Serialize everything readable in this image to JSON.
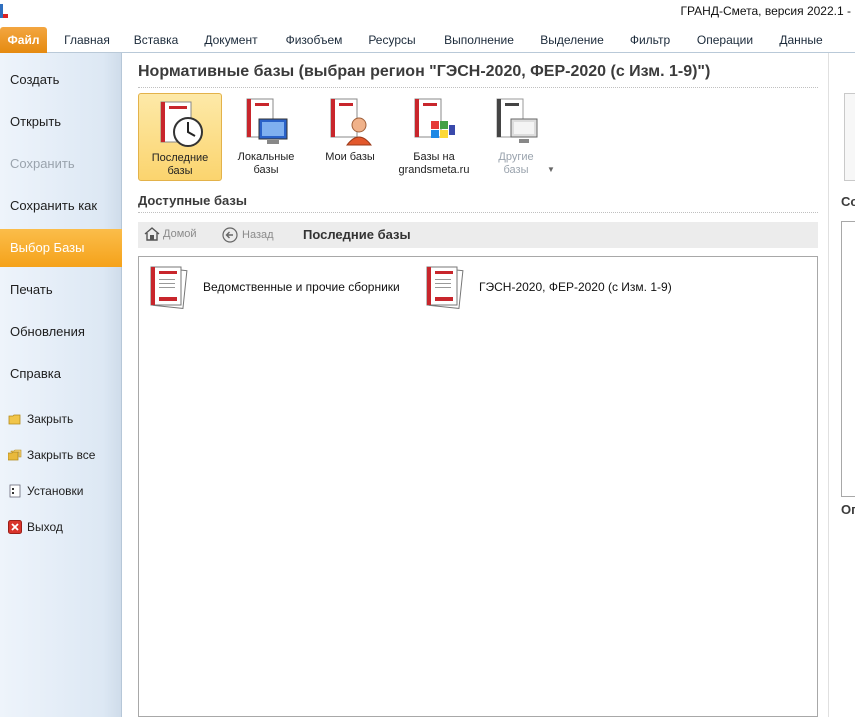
{
  "window": {
    "title": "ГРАНД-Смета, версия 2022.1 -"
  },
  "ribbon": {
    "tabs": [
      "Файл",
      "Главная",
      "Вставка",
      "Документ",
      "Физобъем",
      "Ресурсы",
      "Выполнение",
      "Выделение",
      "Фильтр",
      "Операции",
      "Данные"
    ],
    "active_tab": "Файл"
  },
  "backstage_menu": {
    "items": [
      "Создать",
      "Открыть",
      "Сохранить",
      "Сохранить как",
      "Выбор Базы",
      "Печать",
      "Обновления",
      "Справка"
    ],
    "disabled_item": "Сохранить",
    "active_item": "Выбор Базы",
    "commands": [
      "Закрыть",
      "Закрыть все",
      "Установки",
      "Выход"
    ]
  },
  "main": {
    "heading": "Нормативные базы (выбран регион \"ГЭСН-2020, ФЕР-2020 (с Изм. 1-9)\")",
    "buttons": [
      {
        "label": "Последние\nбазы",
        "icon": "recent-bases-clock-icon",
        "selected": true
      },
      {
        "label": "Локальные\nбазы",
        "icon": "local-bases-computer-icon"
      },
      {
        "label": "Мои базы",
        "icon": "my-bases-user-icon"
      },
      {
        "label": "Базы на\ngrandsmeta.ru",
        "icon": "online-bases-icon"
      },
      {
        "label": "Другие\nбазы",
        "icon": "other-bases-icon",
        "disabled": true
      }
    ],
    "available_heading": "Доступные базы",
    "nav": {
      "home": "Домой",
      "back": "Назад",
      "title": "Последние базы"
    },
    "list": [
      {
        "label": "Ведомственные и прочие сборники",
        "icon": "book-stack-icon"
      },
      {
        "label": "ГЭСН-2020, ФЕР-2020 (с Изм. 1-9)",
        "icon": "book-stack-icon"
      }
    ]
  },
  "right_panel": {
    "text1": "Со",
    "text2": "Оп"
  },
  "colors": {
    "accent_orange": "#f5a21a",
    "selected_button": "#fbd46e",
    "book_red": "#c8262c"
  }
}
